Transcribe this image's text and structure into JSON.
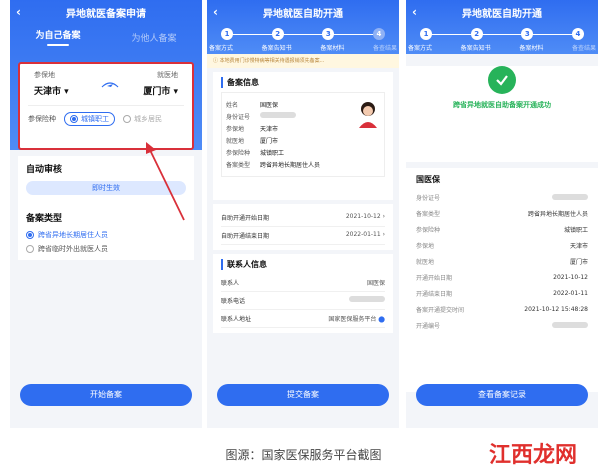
{
  "screen1": {
    "title": "异地就医备案申请",
    "tab_self": "为自己备案",
    "tab_other": "为他人备案",
    "insured_place_label": "参保地",
    "treatment_place_label": "就医地",
    "insured_city": "天津市",
    "treatment_city": "厦门市",
    "insurance_type_label": "参保险种",
    "insurance_opt1": "城镇职工",
    "insurance_opt2": "城乡居民",
    "auto_review_title": "自动审核",
    "auto_review_value": "即时生效",
    "filing_type_title": "备案类型",
    "filing_opt1": "跨省异地长期居住人员",
    "filing_opt2": "跨省临时外出就医人员",
    "submit": "开始备案"
  },
  "screen2": {
    "title": "异地就医自助开通",
    "steps": [
      "1",
      "2",
      "3",
      "4"
    ],
    "step_labels": [
      "备案方式",
      "备案告知书",
      "备案材料",
      "备查结果"
    ],
    "notice": "本地费用门诊慢特病等相关待遇报销须先备案...",
    "info_title": "备案信息",
    "fields": [
      {
        "k": "姓名",
        "v": "国医保"
      },
      {
        "k": "身份证号",
        "v": ""
      },
      {
        "k": "参保地",
        "v": "天津市"
      },
      {
        "k": "就医地",
        "v": "厦门市"
      },
      {
        "k": "参保险种",
        "v": "城镇职工"
      },
      {
        "k": "备案类型",
        "v": "跨省异地长期居住人员"
      }
    ],
    "start_label": "自助开通开始日期",
    "start_value": "2021-10-12",
    "end_label": "自助开通结束日期",
    "end_value": "2022-01-11",
    "contact_title": "联系人信息",
    "contact_name_label": "联系人",
    "contact_name_value": "国医保",
    "contact_phone_label": "联系电话",
    "contact_addr_label": "联系人地址",
    "contact_addr_value": "国家医保服务平台",
    "submit": "提交备案"
  },
  "screen3": {
    "title": "异地就医自助开通",
    "steps": [
      "1",
      "2",
      "3",
      "4"
    ],
    "step_labels": [
      "备案方式",
      "备案告知书",
      "备案材料",
      "备查结果"
    ],
    "success": "跨省异地就医自助备案开通成功",
    "name": "国医保",
    "rows": [
      {
        "k": "身份证号",
        "v": ""
      },
      {
        "k": "备案类型",
        "v": "跨省异地长期居住人员"
      },
      {
        "k": "参保险种",
        "v": "城镇职工"
      },
      {
        "k": "参保地",
        "v": "天津市"
      },
      {
        "k": "就医地",
        "v": "厦门市"
      },
      {
        "k": "开通开始日期",
        "v": "2021-10-12"
      },
      {
        "k": "开通结束日期",
        "v": "2022-01-11"
      },
      {
        "k": "备案开通提交时间",
        "v": "2021-10-12 15:48:28"
      },
      {
        "k": "开通编号",
        "v": ""
      }
    ],
    "submit": "查看备案记录"
  },
  "caption": "图源：国家医保服务平台截图",
  "watermark": "江西龙网",
  "colors": {
    "primary": "#2f6df0",
    "success": "#27b35a",
    "highlight": "#d9303a"
  }
}
